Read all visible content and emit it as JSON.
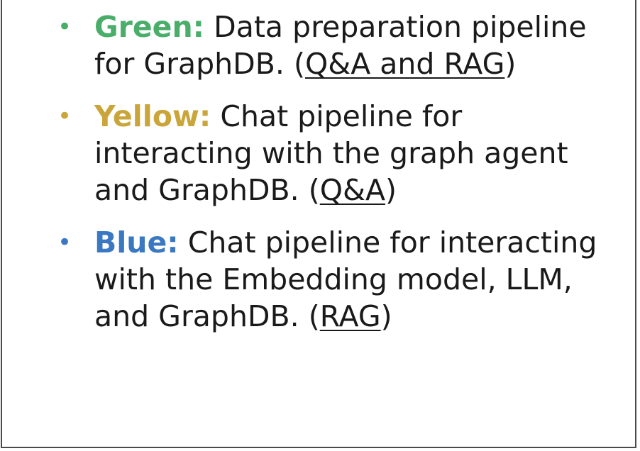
{
  "items": [
    {
      "label": "Green:",
      "text": "Data preparation pipeline for GraphDB.",
      "paren_open": "(",
      "link": "Q&A and RAG",
      "paren_close": ")",
      "color": "#4aae6a"
    },
    {
      "label": "Yellow:",
      "text": "Chat pipeline for interacting with the graph agent and GraphDB.",
      "paren_open": "(",
      "link": "Q&A",
      "paren_close": ")",
      "color": "#c9a53a"
    },
    {
      "label": "Blue:",
      "text": "Chat pipeline for interacting with the Embedding model, LLM, and GraphDB.",
      "paren_open": "(",
      "link": "RAG",
      "paren_close": ")",
      "color": "#3a78c2"
    }
  ],
  "bullet_glyph": "•"
}
